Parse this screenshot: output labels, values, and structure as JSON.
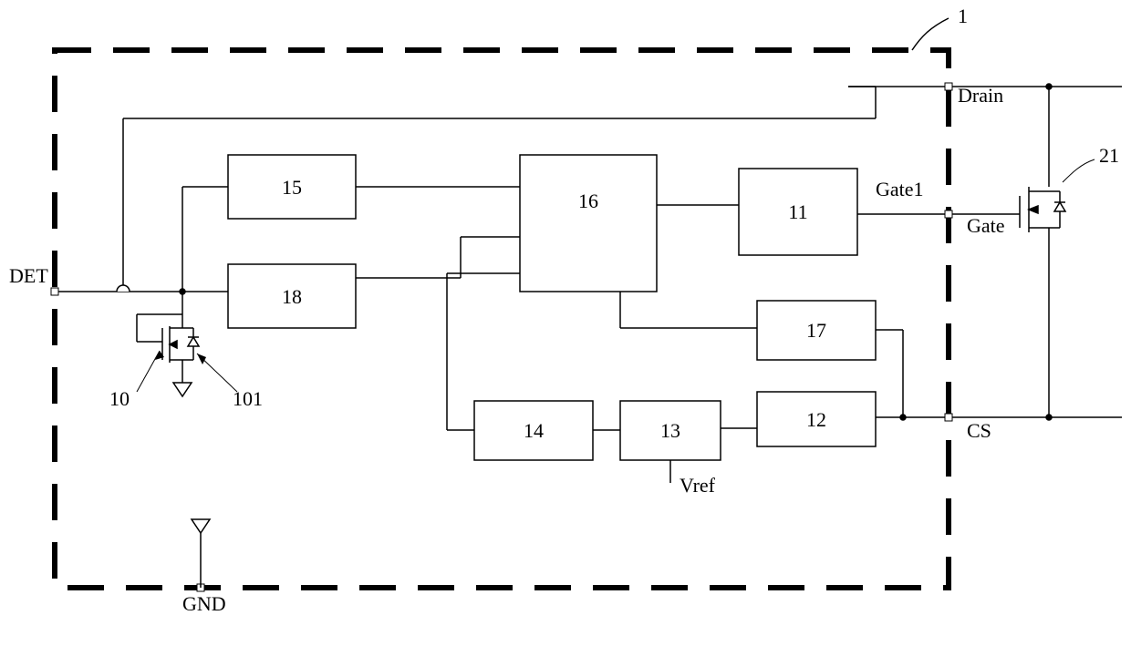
{
  "pins": {
    "det": "DET",
    "gnd": "GND",
    "drain": "Drain",
    "gate": "Gate",
    "gate1": "Gate1",
    "cs": "CS",
    "vref": "Vref"
  },
  "blocks": {
    "b10": "10",
    "b101": "101",
    "b11": "11",
    "b12": "12",
    "b13": "13",
    "b14": "14",
    "b15": "15",
    "b16": "16",
    "b17": "17",
    "b18": "18"
  },
  "refs": {
    "ic": "1",
    "ext_fet": "21"
  }
}
